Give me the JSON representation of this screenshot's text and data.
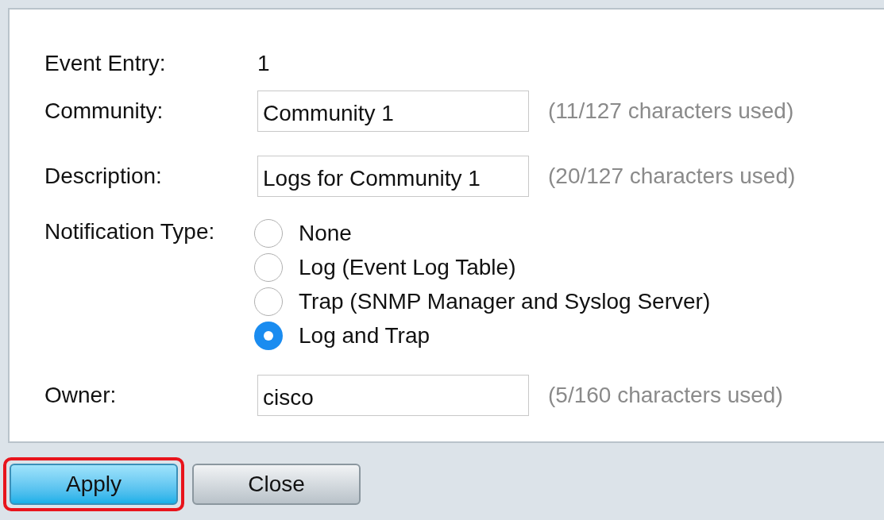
{
  "form": {
    "event_entry": {
      "label": "Event Entry:",
      "value": "1"
    },
    "fields": [
      {
        "label": "Community:",
        "value": "Community 1",
        "hint": "(11/127 characters used)"
      },
      {
        "label": "Description:",
        "value": "Logs for Community 1",
        "hint": "(20/127 characters used)"
      }
    ],
    "notification_type": {
      "label": "Notification Type:",
      "options": [
        {
          "label": "None",
          "selected": false
        },
        {
          "label": "Log (Event Log Table)",
          "selected": false
        },
        {
          "label": "Trap (SNMP Manager and Syslog Server)",
          "selected": false
        },
        {
          "label": "Log and Trap",
          "selected": true
        }
      ]
    },
    "owner": {
      "label": "Owner:",
      "value": "cisco",
      "hint": "(5/160 characters used)"
    }
  },
  "buttons": [
    {
      "label": "Apply",
      "kind": "primary",
      "highlighted": true
    },
    {
      "label": "Close",
      "kind": "secondary",
      "highlighted": false
    }
  ]
}
